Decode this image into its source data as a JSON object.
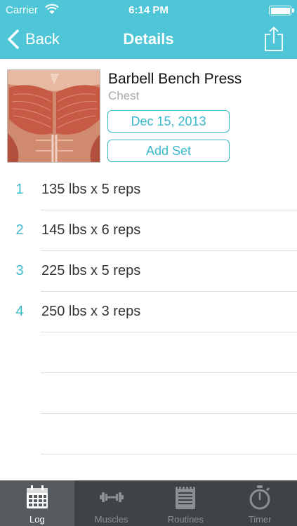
{
  "status_bar": {
    "carrier": "Carrier",
    "time": "6:14 PM"
  },
  "nav": {
    "back_label": "Back",
    "title": "Details"
  },
  "exercise": {
    "name": "Barbell Bench Press",
    "muscle_group": "Chest",
    "date": "Dec 15, 2013",
    "add_set_label": "Add Set"
  },
  "sets": [
    {
      "num": "1",
      "text": "135 lbs x 5 reps"
    },
    {
      "num": "2",
      "text": "145 lbs x 6 reps"
    },
    {
      "num": "3",
      "text": "225 lbs x 5 reps"
    },
    {
      "num": "4",
      "text": "250 lbs x 3 reps"
    }
  ],
  "tabs": [
    {
      "label": "Log",
      "icon": "calendar-icon"
    },
    {
      "label": "Muscles",
      "icon": "dumbbell-icon"
    },
    {
      "label": "Routines",
      "icon": "notepad-icon"
    },
    {
      "label": "Timer",
      "icon": "stopwatch-icon"
    }
  ],
  "colors": {
    "accent": "#4ec6d7",
    "accent_text": "#3bb8cc",
    "tabbar": "#3e4347"
  }
}
